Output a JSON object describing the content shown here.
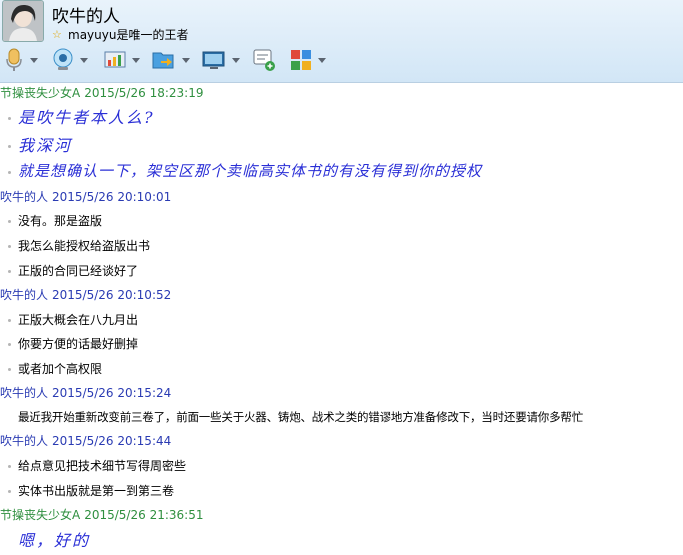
{
  "contact": {
    "name": "吹牛的人",
    "signature": "mayuyu是唯一的王者"
  },
  "toolbar": {
    "items": [
      {
        "icon": "microphone-icon"
      },
      {
        "icon": "webcam-icon"
      },
      {
        "icon": "share-screen-icon"
      },
      {
        "icon": "send-file-icon"
      },
      {
        "icon": "remote-assist-icon"
      },
      {
        "icon": "new-message-icon"
      },
      {
        "icon": "apps-grid-icon"
      }
    ]
  },
  "messages": [
    {
      "sender": "节操丧失少女A",
      "time": "2015/5/26 18:23:19",
      "side": "them",
      "lines": [
        "是吹牛者本人么?",
        "我深河",
        "就是想确认一下，架空区那个卖临高实体书的有没有得到你的授权"
      ]
    },
    {
      "sender": "吹牛的人",
      "time": "2015/5/26 20:10:01",
      "side": "me",
      "lines": [
        "没有。那是盗版",
        "我怎么能授权给盗版出书",
        "正版的合同已经谈好了"
      ]
    },
    {
      "sender": "吹牛的人",
      "time": "2015/5/26 20:10:52",
      "side": "me",
      "lines": [
        "正版大概会在八九月出",
        "你要方便的话最好删掉",
        "或者加个高权限"
      ]
    },
    {
      "sender": "吹牛的人",
      "time": "2015/5/26 20:15:24",
      "side": "me",
      "lines": [
        "最近我开始重新改变前三卷了，前面一些关于火器、铸炮、战术之类的错谬地方准备修改下，当时还要请你多帮忙"
      ]
    },
    {
      "sender": "吹牛的人",
      "time": "2015/5/26 20:15:44",
      "side": "me",
      "lines": [
        "给点意见把技术细节写得周密些",
        "实体书出版就是第一到第三卷"
      ]
    },
    {
      "sender": "节操丧失少女A",
      "time": "2015/5/26 21:36:51",
      "side": "them",
      "lines": [
        "嗯，好的"
      ]
    }
  ],
  "colors": {
    "them_header": "#2f8f3f",
    "me_header": "#2a3bb3",
    "handwriting": "#2a2fd6"
  }
}
